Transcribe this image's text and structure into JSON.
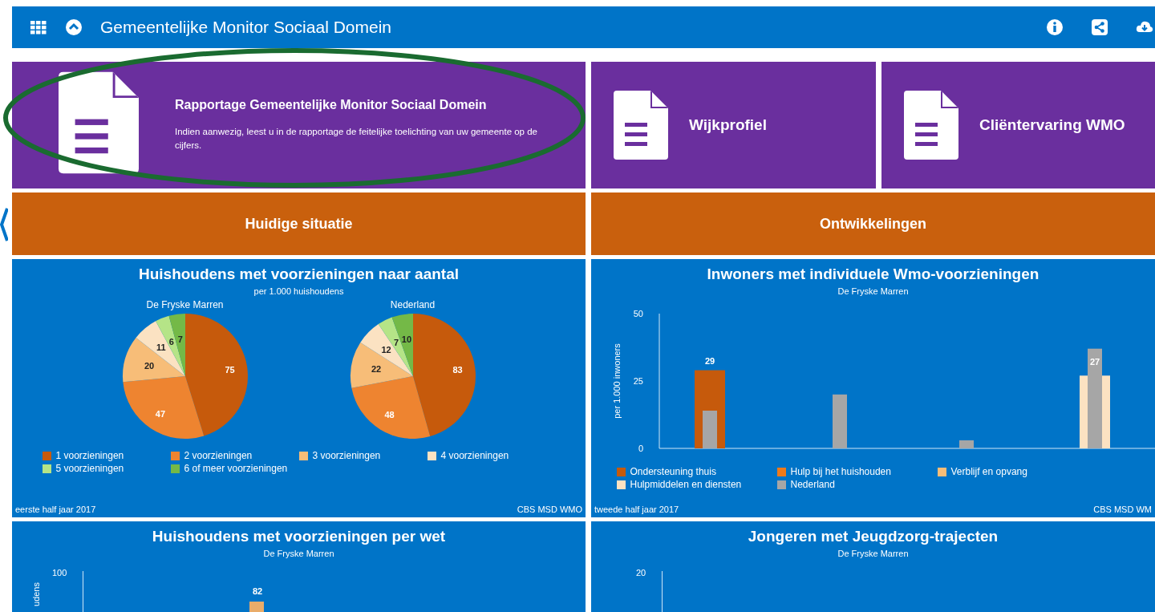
{
  "header": {
    "title": "Gemeentelijke Monitor Sociaal Domein"
  },
  "tiles": [
    {
      "title": "Rapportage Gemeentelijke Monitor Sociaal Domein",
      "description": "Indien aanwezig, leest u in de rapportage de feitelijke toelichting van uw gemeente op de cijfers.",
      "annotation": {
        "kind": "ellipse",
        "color": "#1a6b30"
      }
    },
    {
      "title": "Wijkprofiel"
    },
    {
      "title": "Cliëntervaring WMO"
    }
  ],
  "sections": [
    {
      "label": "Huidige situatie"
    },
    {
      "label": "Ontwikkelingen"
    }
  ],
  "pie_panel": {
    "title": "Huishoudens met voorzieningen naar aantal",
    "subtitle": "per 1.000 huishoudens",
    "footer_left": "eerste half jaar 2017",
    "footer_right": "CBS MSD WMO",
    "legend": [
      {
        "label": "1 voorzieningen",
        "color": "#c65a0c"
      },
      {
        "label": "2 voorzieningen",
        "color": "#ee8430"
      },
      {
        "label": "3 voorzieningen",
        "color": "#f7bd78"
      },
      {
        "label": "4 voorzieningen",
        "color": "#fbe2c2"
      },
      {
        "label": "5 voorzieningen",
        "color": "#b5e487"
      },
      {
        "label": "6 of meer voorzieningen",
        "color": "#74b947"
      }
    ],
    "charts": [
      {
        "chart_data": {
          "type": "pie",
          "title": "De Fryske Marren",
          "values": [
            75,
            47,
            20,
            11,
            6,
            7
          ],
          "data_labels": true
        }
      },
      {
        "chart_data": {
          "type": "pie",
          "title": "Nederland",
          "values": [
            83,
            48,
            22,
            12,
            7,
            10
          ],
          "data_labels": true
        }
      }
    ]
  },
  "bar_panel": {
    "title": "Inwoners met individuele Wmo-voorzieningen",
    "subtitle": "De Fryske Marren",
    "footer_left": "tweede half jaar 2017",
    "footer_right": "CBS MSD WM",
    "chart_data": {
      "type": "bar",
      "ylabel": "per 1.000 inwoners",
      "ylim": [
        0,
        50
      ],
      "yticks": [
        0,
        25,
        50
      ],
      "legend": true,
      "annotations": [
        {
          "text": "29",
          "y": 29
        },
        {
          "text": "27",
          "y": 27
        }
      ],
      "series": [
        {
          "name": "Ondersteuning thuis",
          "color": "#c65a0c",
          "values": [
            29,
            null,
            null,
            null
          ]
        },
        {
          "name": "Hulp bij het huishouden",
          "color": "#ee7a1a",
          "values": [
            null,
            null,
            null,
            null
          ]
        },
        {
          "name": "Verblijf en opvang",
          "color": "#f7bd78",
          "values": [
            null,
            null,
            null,
            null
          ]
        },
        {
          "name": "Hulpmiddelen en diensten",
          "color": "#fbe2c2",
          "values": [
            null,
            null,
            null,
            27
          ]
        },
        {
          "name": "Nederland",
          "color": "#a6a6a6",
          "values": [
            14,
            20,
            3,
            37
          ]
        }
      ]
    }
  },
  "lower_panels": [
    {
      "title": "Huishoudens met voorzieningen per wet",
      "subtitle": "De Fryske Marren",
      "ylabel": "udens",
      "tick": "100",
      "bar_label": "82"
    },
    {
      "title": "Jongeren met Jeugdzorg-trajecten",
      "subtitle": "De Fryske Marren",
      "tick": "20"
    }
  ]
}
